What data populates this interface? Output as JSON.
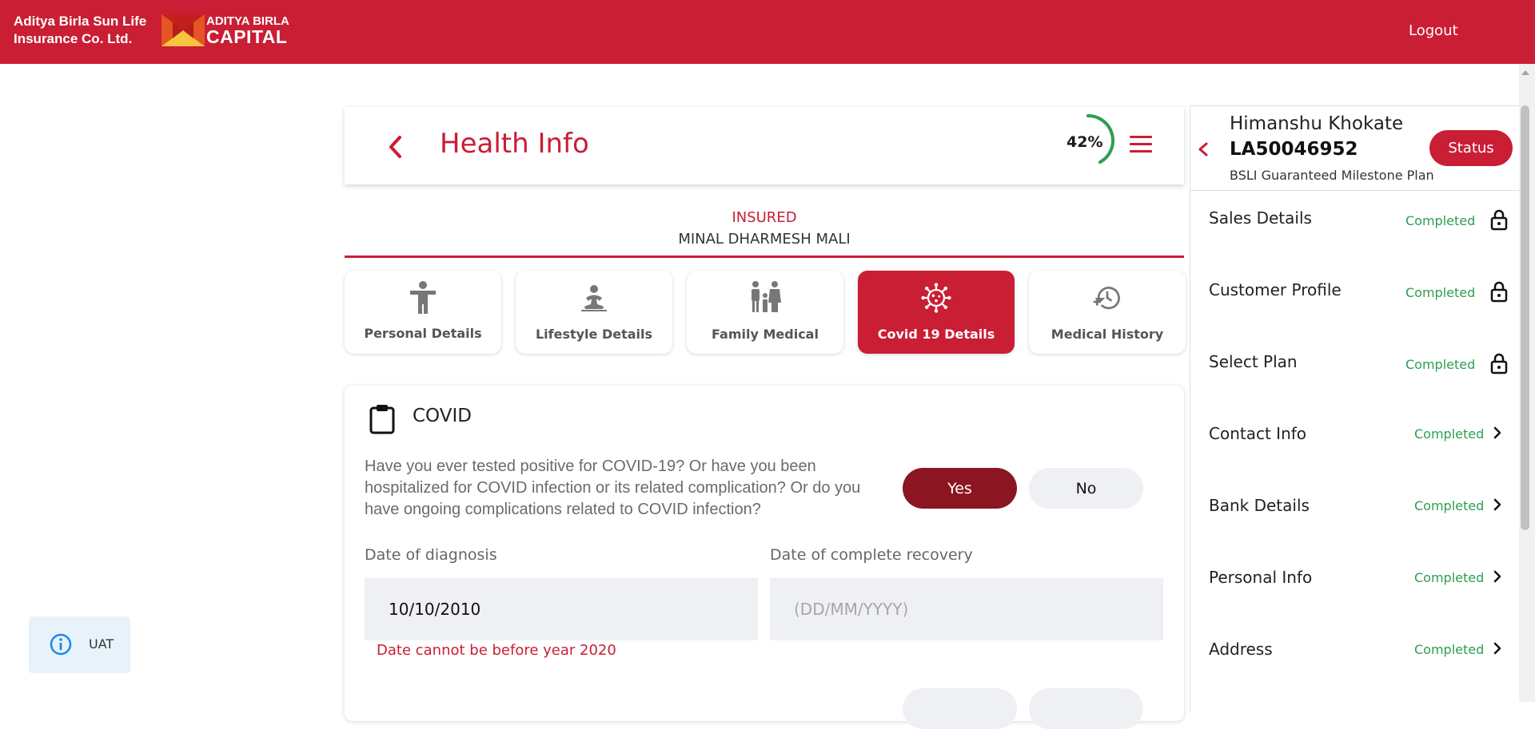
{
  "header": {
    "brand_line1": "Aditya Birla Sun Life",
    "brand_line2": "Insurance Co. Ltd.",
    "logo_line1": "ADITYA BIRLA",
    "logo_line2": "CAPITAL",
    "logout": "Logout"
  },
  "page": {
    "title": "Health Info",
    "progress_label": "42%",
    "progress_value": 0.42,
    "insured_label": "INSURED",
    "insured_name": "MINAL DHARMESH MALI"
  },
  "tabs": [
    {
      "label": "Personal Details",
      "icon": "person-icon",
      "active": false
    },
    {
      "label": "Lifestyle Details",
      "icon": "meditation-icon",
      "active": false
    },
    {
      "label": "Family Medical",
      "icon": "family-icon",
      "active": false
    },
    {
      "label": "Covid 19 Details",
      "icon": "virus-icon",
      "active": true
    },
    {
      "label": "Medical History",
      "icon": "history-icon",
      "active": false
    }
  ],
  "covid": {
    "title": "COVID",
    "question": "Have you ever tested positive for COVID-19? Or have you been hospitalized for COVID infection or its related complication? Or do you have ongoing complications related to COVID infection?",
    "yes": "Yes",
    "no": "No",
    "diagnosis_label": "Date of diagnosis",
    "diagnosis_value": "10/10/2010",
    "recovery_label": "Date of complete recovery",
    "recovery_placeholder": "(DD/MM/YYYY)",
    "error": "Date cannot be before year 2020"
  },
  "uat": {
    "label": "UAT"
  },
  "side": {
    "name": "Himanshu Khokate",
    "id": "LA50046952",
    "plan": "BSLI Guaranteed Milestone Plan",
    "status_button": "Status",
    "steps": [
      {
        "name": "Sales Details",
        "status": "Completed",
        "icon": "lock-icon"
      },
      {
        "name": "Customer Profile",
        "status": "Completed",
        "icon": "lock-icon"
      },
      {
        "name": "Select Plan",
        "status": "Completed",
        "icon": "lock-icon"
      },
      {
        "name": "Contact Info",
        "status": "Completed",
        "icon": "chevron-right-icon"
      },
      {
        "name": "Bank Details",
        "status": "Completed",
        "icon": "chevron-right-icon"
      },
      {
        "name": "Personal Info",
        "status": "Completed",
        "icon": "chevron-right-icon"
      },
      {
        "name": "Address",
        "status": "Completed",
        "icon": "chevron-right-icon"
      }
    ]
  },
  "colors": {
    "brand_red": "#c91e34",
    "dark_red": "#8b1520",
    "success_green": "#2e9e4f"
  }
}
